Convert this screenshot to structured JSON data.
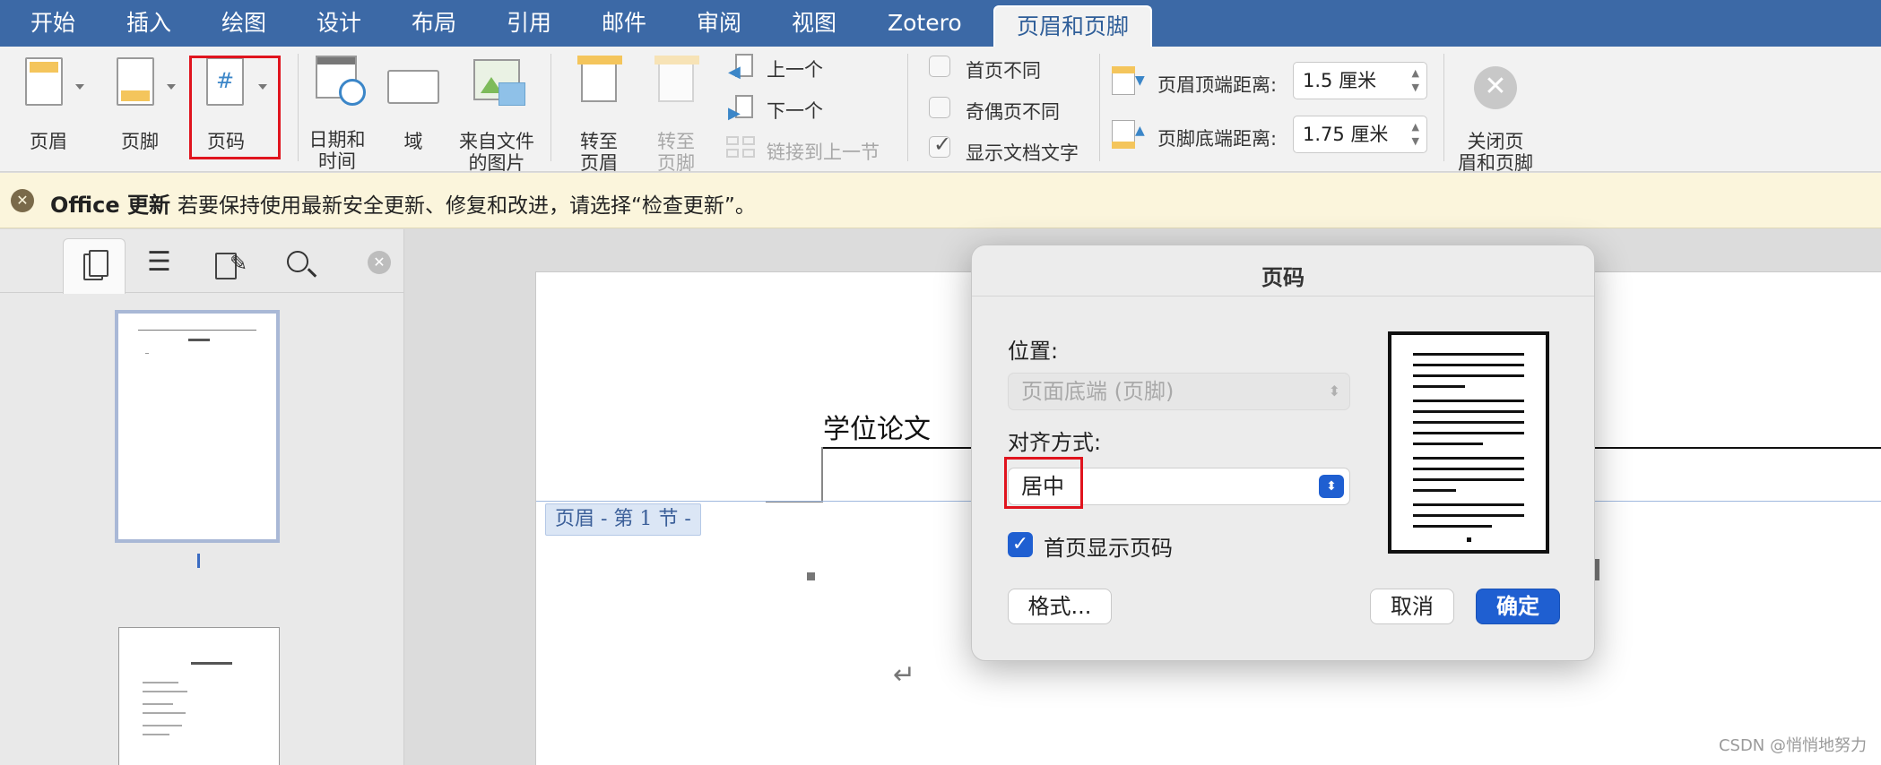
{
  "tabs": [
    "开始",
    "插入",
    "绘图",
    "设计",
    "布局",
    "引用",
    "邮件",
    "审阅",
    "视图",
    "Zotero"
  ],
  "active_tab": "页眉和页脚",
  "ribbon": {
    "header": "页眉",
    "footer": "页脚",
    "page_number": "页码",
    "date_time": "日期和\n时间",
    "field": "域",
    "picture_from_file": "来自文件\n的图片",
    "goto_header": "转至\n页眉",
    "goto_footer": "转至\n页脚",
    "previous": "上一个",
    "next": "下一个",
    "link_previous": "链接到上一节",
    "different_first_page": "首页不同",
    "different_odd_even": "奇偶页不同",
    "show_document_text": "显示文档文字",
    "header_from_top_label": "页眉顶端距离:",
    "header_from_top_value": "1.5 厘米",
    "footer_from_bottom_label": "页脚底端距离:",
    "footer_from_bottom_value": "1.75 厘米",
    "close": "关闭页\n眉和页脚"
  },
  "update_bar": {
    "title": "Office 更新",
    "message": "若要保持使用最新安全更新、修复和改进，请选择“检查更新”。"
  },
  "document": {
    "header_text": "学位论文",
    "header_tag": "页眉 - 第 1 节 -",
    "para_mark": "↵"
  },
  "dialog": {
    "title": "页码",
    "position_label": "位置:",
    "position_value": "页面底端 (页脚)",
    "alignment_label": "对齐方式:",
    "alignment_value": "居中",
    "show_on_first_page": "首页显示页码",
    "format_button": "格式...",
    "cancel_button": "取消",
    "ok_button": "确定"
  },
  "watermark": "CSDN @悄悄地努力",
  "colors": {
    "tab_bar": "#3c69a6",
    "ribbon_bg": "#f2f2f2",
    "update_bar_bg": "#fbf5dc",
    "highlight": "#e0141e",
    "primary_button": "#1f5fd1",
    "checkbox": "#1f5fd1"
  }
}
